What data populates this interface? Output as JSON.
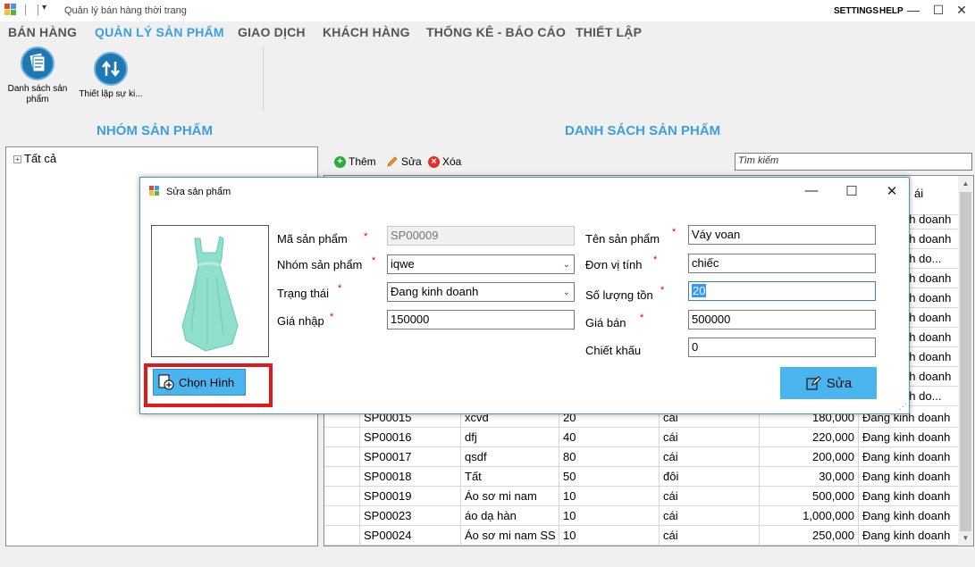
{
  "titlebar": {
    "title": "Quản lý bán hàng thời trang",
    "settings": "SETTINGS",
    "help": "HELP",
    "minimize": "—",
    "maximize": "☐",
    "close": "✕"
  },
  "ribbon": {
    "tabs": [
      "BÁN HÀNG",
      "QUẢN LÝ SẢN PHẨM",
      "GIAO DỊCH",
      "KHÁCH HÀNG",
      "THỐNG KÊ - BÁO CÁO",
      "THIẾT LẬP"
    ],
    "active_tab": "QUẢN LÝ SẢN PHẨM",
    "buttons": [
      {
        "label": "Danh sách sản phẩm",
        "icon": "product-list-icon"
      },
      {
        "label": "Thiết lập sự ki...",
        "icon": "event-setup-icon"
      }
    ]
  },
  "left_panel": {
    "title": "NHÓM SẢN PHẨM",
    "tree_root": "Tất cả"
  },
  "right_panel": {
    "title": "DANH SÁCH SẢN PHẨM",
    "toolbar": {
      "add": "Thêm",
      "edit": "Sửa",
      "delete": "Xóa"
    },
    "search_placeholder": "Tìm kiếm",
    "header_fragment": "ái",
    "right_fragments": [
      "Đang kinh doanh",
      "Đang kinh doanh",
      "Đang kinh do...",
      "Đang kinh doanh",
      "Đang kinh doanh",
      "Đang kinh doanh",
      "Đang kinh doanh",
      "Đang kinh doanh",
      "Đang kinh doanh",
      "Đang kinh do..."
    ],
    "rows": [
      {
        "code": "SP00015",
        "name": "xcvd",
        "qty": "20",
        "unit": "cái",
        "price": "180,000",
        "status": "Đang kinh doanh"
      },
      {
        "code": "SP00016",
        "name": "dfj",
        "qty": "40",
        "unit": "cái",
        "price": "220,000",
        "status": "Đang kinh doanh"
      },
      {
        "code": "SP00017",
        "name": "qsdf",
        "qty": "80",
        "unit": "cái",
        "price": "200,000",
        "status": "Đang kinh doanh"
      },
      {
        "code": "SP00018",
        "name": "Tất",
        "qty": "50",
        "unit": "đôi",
        "price": "30,000",
        "status": "Đang kinh doanh"
      },
      {
        "code": "SP00019",
        "name": "Áo sơ mi nam",
        "qty": "10",
        "unit": "cái",
        "price": "500,000",
        "status": "Đang kinh doanh"
      },
      {
        "code": "SP00023",
        "name": "áo dạ hàn",
        "qty": "10",
        "unit": "cái",
        "price": "1,000,000",
        "status": "Đang kinh doanh"
      },
      {
        "code": "SP00024",
        "name": "Áo sơ mi nam SS",
        "qty": "10",
        "unit": "cái",
        "price": "250,000",
        "status": "Đang kinh doanh"
      }
    ]
  },
  "dialog": {
    "title": "Sửa sản phẩm",
    "choose_image": "Chọn Hình",
    "save": "Sửa",
    "fields": {
      "code_label": "Mã sản phẩm",
      "code_value": "SP00009",
      "group_label": "Nhóm sản phẩm",
      "group_value": "iqwe",
      "status_label": "Trạng thái",
      "status_value": "Đang kinh doanh",
      "cost_label": "Giá nhập",
      "cost_value": "150000",
      "name_label": "Tên sản phẩm",
      "name_value": "Váy voan",
      "unit_label": "Đơn vị tính",
      "unit_value": "chiếc",
      "stock_label": "Số lượng tồn",
      "stock_value": "20",
      "price_label": "Giá bán",
      "price_value": "500000",
      "discount_label": "Chiết khấu",
      "discount_value": "0"
    },
    "required_mark": "*"
  },
  "colors": {
    "accent": "#3b9fe0",
    "button_blue": "#4ab4ee",
    "highlight_red": "#e0191b",
    "dress": "#8ee0cc"
  }
}
